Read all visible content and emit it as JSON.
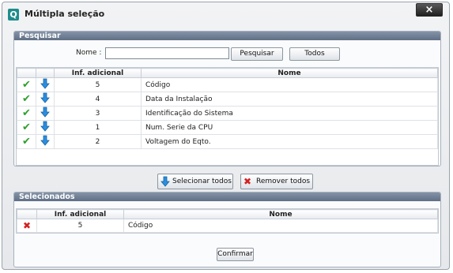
{
  "window": {
    "title": "Múltipla seleção",
    "close_label": "×",
    "app_icon_letter": "Q"
  },
  "search": {
    "header": "Pesquisar",
    "name_label": "Nome :",
    "name_value": "",
    "search_button": "Pesquisar",
    "all_button": "Todos"
  },
  "results": {
    "columns": [
      "",
      "",
      "Inf. adicional",
      "Nome"
    ],
    "rows": [
      {
        "info": "5",
        "name": "Código"
      },
      {
        "info": "4",
        "name": "Data da Instalação"
      },
      {
        "info": "3",
        "name": "Identificação do Sistema"
      },
      {
        "info": "1",
        "name": "Num. Serie da CPU"
      },
      {
        "info": "2",
        "name": "Voltagem do Eqto."
      }
    ]
  },
  "actions": {
    "select_all": "Selecionar todos",
    "remove_all": "Remover todos"
  },
  "selected": {
    "header": "Selecionados",
    "columns": [
      "",
      "Inf. adicional",
      "Nome"
    ],
    "rows": [
      {
        "info": "5",
        "name": "Código"
      }
    ]
  },
  "confirm_button": "Confirmar",
  "icons": {
    "check": "check-icon",
    "down": "arrow-down-icon",
    "remove": "x-icon"
  },
  "colors": {
    "header_bar": "#6a7a8f",
    "check": "#2ea02e",
    "arrow": "#2b8ee0",
    "remove": "#d42020"
  }
}
